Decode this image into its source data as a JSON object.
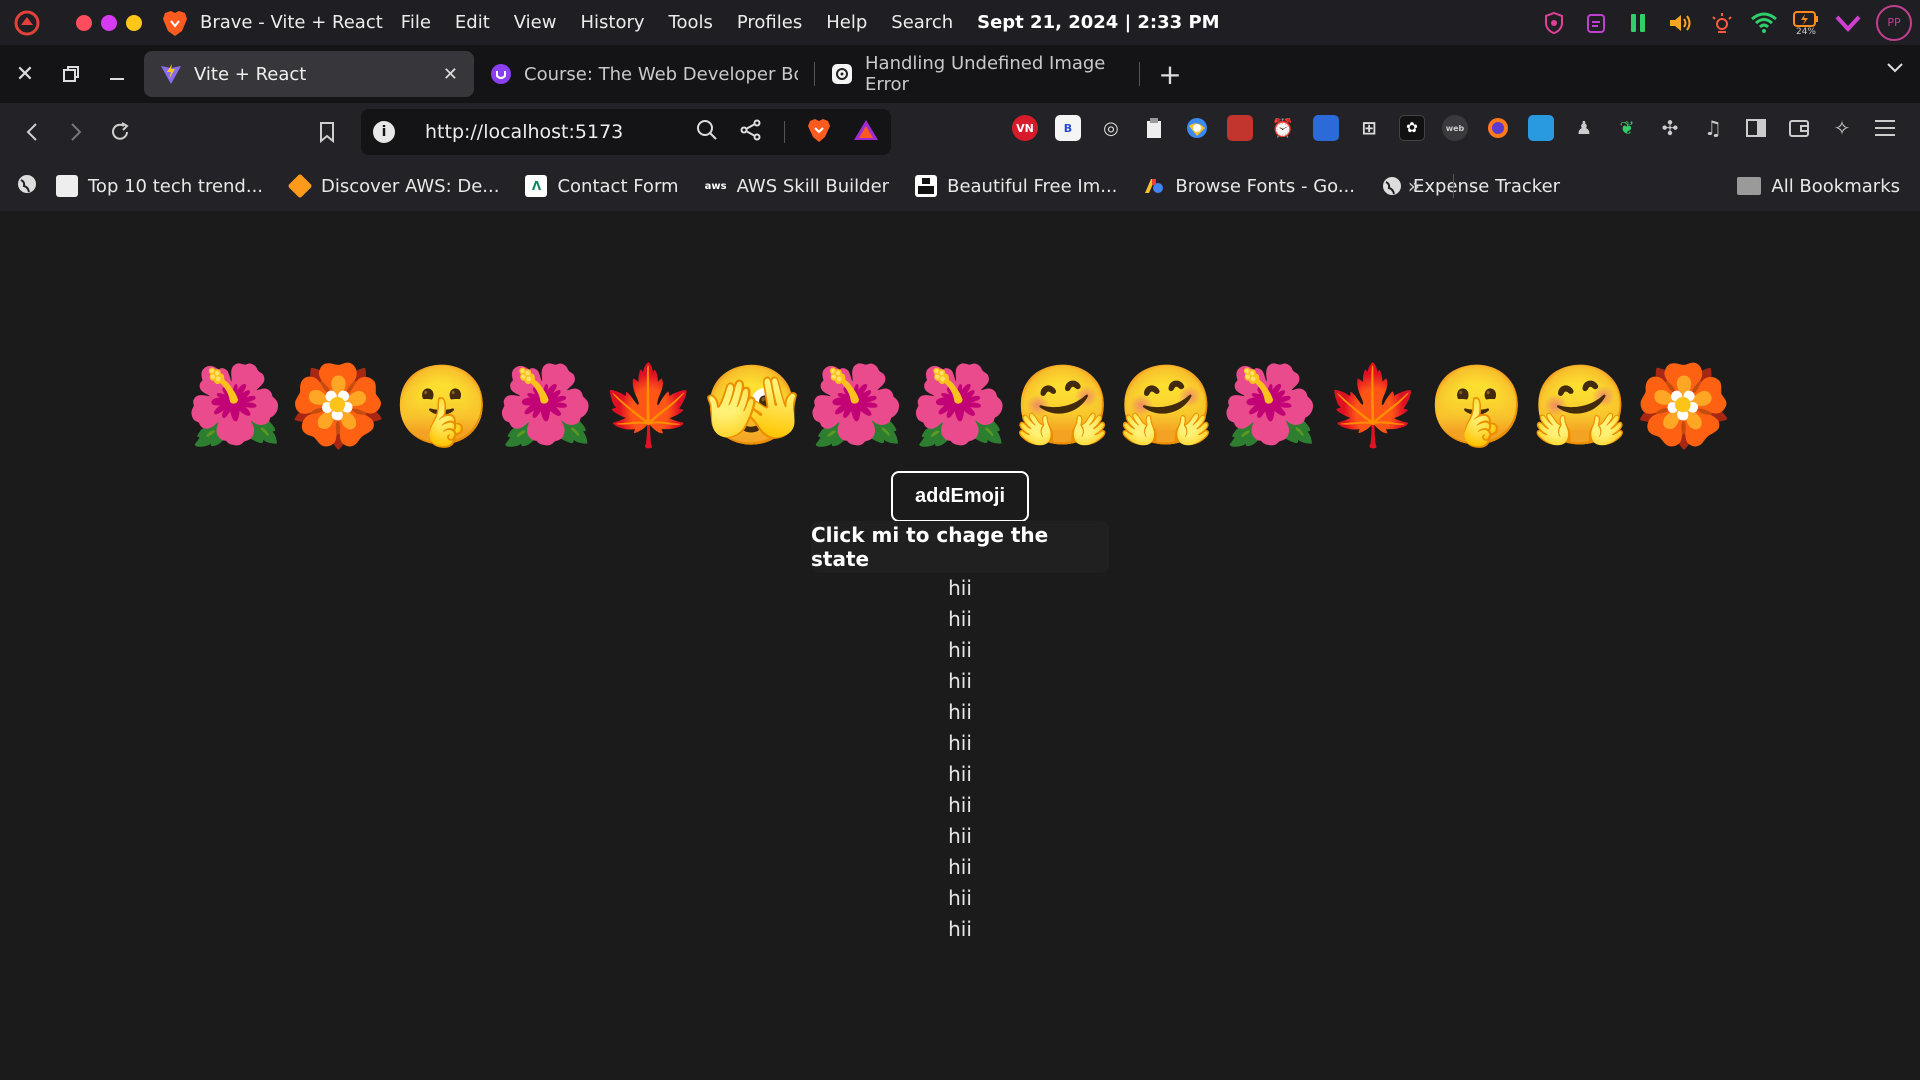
{
  "system_bar": {
    "app_title": "Brave - Vite + React",
    "menu": [
      "File",
      "Edit",
      "View",
      "History",
      "Tools",
      "Profiles",
      "Help",
      "Search"
    ],
    "clock": "Sept 21, 2024 | 2:33 PM",
    "battery_percent": "24%",
    "avatar_initials": "PP"
  },
  "tabs": [
    {
      "label": "Vite + React",
      "active": true
    },
    {
      "label": "Course: The Web Developer Boot",
      "active": false
    },
    {
      "label": "Handling Undefined Image Error",
      "active": false
    }
  ],
  "toolbar": {
    "url_host": "http://localhost:",
    "url_port": "5173",
    "extensions": [
      "VN",
      "B"
    ]
  },
  "bookmarks": [
    {
      "label": "Top 10 tech trend...",
      "icon": "page-icon"
    },
    {
      "label": "Discover AWS: De...",
      "icon": "aws-cube-icon"
    },
    {
      "label": "Contact Form",
      "icon": "form-logo-icon"
    },
    {
      "label": "AWS Skill Builder",
      "icon": "aws-icon"
    },
    {
      "label": "Beautiful Free Im...",
      "icon": "unsplash-icon"
    },
    {
      "label": "Browse Fonts - Go...",
      "icon": "google-fonts-icon"
    },
    {
      "label": "Expense Tracker",
      "icon": "globe-icon"
    }
  ],
  "all_bookmarks_label": "All Bookmarks",
  "content": {
    "emojis": [
      "🌺",
      "🏵️",
      "🤫",
      "🌺",
      "🍁",
      "🫣",
      "🌺",
      "🌺",
      "🤗",
      "🤗",
      "🌺",
      "🍁",
      "🤫",
      "🤗",
      "🏵️"
    ],
    "button_label": "addEmoji",
    "state_text": "Click mi to chage the state",
    "list_items": [
      "hii",
      "hii",
      "hii",
      "hii",
      "hii",
      "hii",
      "hii",
      "hii",
      "hii",
      "hii",
      "hii",
      "hii"
    ]
  },
  "colors": {
    "page_bg": "#1b1b1b",
    "traffic_red": "#ff4d5e",
    "traffic_magenta": "#d63bf0",
    "traffic_yellow": "#ffc61a",
    "brave_orange": "#ff5a1f"
  }
}
